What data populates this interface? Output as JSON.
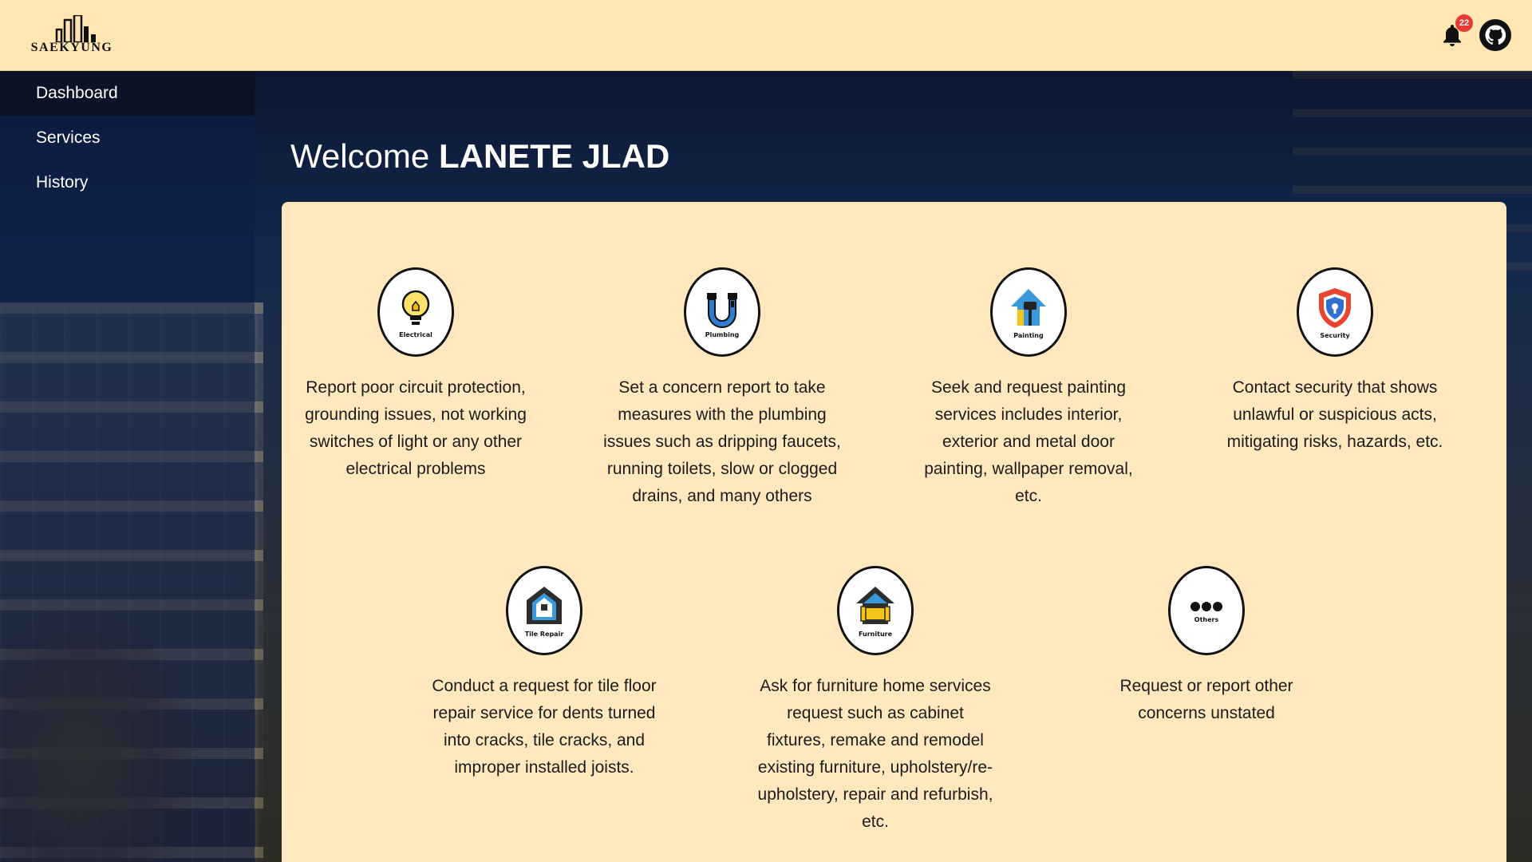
{
  "header": {
    "logo_text": "SAEKYUNG",
    "notification_count": "22"
  },
  "sidebar": {
    "items": [
      {
        "label": "Dashboard"
      },
      {
        "label": "Services"
      },
      {
        "label": "History"
      }
    ]
  },
  "main": {
    "welcome_prefix": "Welcome",
    "user_name": "LANETE JLAD"
  },
  "services": [
    {
      "icon_label": "Electrical",
      "icon": "lightbulb-icon",
      "description": "Report poor circuit protection, grounding issues, not working switches of light or any other electrical problems"
    },
    {
      "icon_label": "Plumbing",
      "icon": "pipe-faucet-icon",
      "description": "Set a concern report to take measures with the plumbing issues such as dripping faucets, running toilets, slow or clogged drains, and many others"
    },
    {
      "icon_label": "Painting",
      "icon": "paint-roller-icon",
      "description": "Seek and request painting services includes interior, exterior and metal door painting, wallpaper removal, etc."
    },
    {
      "icon_label": "Security",
      "icon": "shield-lock-icon",
      "description": "Contact security that shows unlawful or suspicious acts, mitigating risks, hazards, etc."
    },
    {
      "icon_label": "Tile Repair",
      "icon": "house-tile-icon",
      "description": "Conduct a request for tile floor repair service for dents turned into cracks, tile cracks, and improper installed joists."
    },
    {
      "icon_label": "Furniture",
      "icon": "sofa-icon",
      "description": "Ask for furniture home services request such as cabinet fixtures, remake and remodel existing furniture, upholstery/re-upholstery, repair and refurbish, etc."
    },
    {
      "icon_label": "Others",
      "icon": "ellipsis-icon",
      "description": "Request or report other concerns unstated"
    }
  ],
  "colors": {
    "header_bg": "#ffe6b3",
    "panel_bg": "#ffe8bd",
    "badge": "#e53935",
    "sidebar_active": "#0b1326"
  }
}
